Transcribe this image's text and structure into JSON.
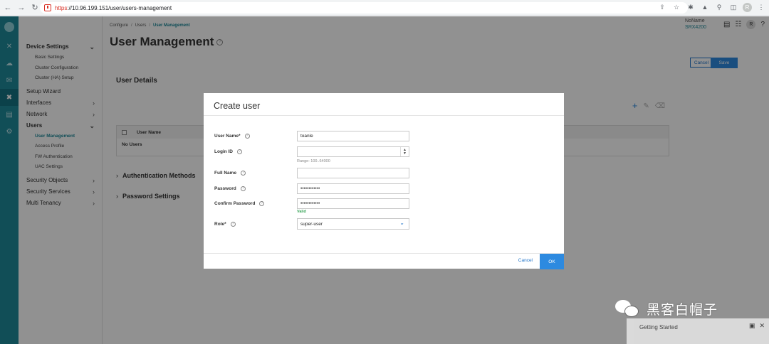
{
  "browser": {
    "url_scheme": "https",
    "url_rest": "://10.96.199.151/user/users-management",
    "profile_initial": "R"
  },
  "header": {
    "breadcrumb": [
      "Configure",
      "Users",
      "User Management"
    ],
    "page_title": "User Management",
    "device_name": "NoName",
    "device_model": "SRX4200",
    "user_initial": "R",
    "help_glyph": "?",
    "cancel_label": "Cancel",
    "save_label": "Save"
  },
  "sidebar": {
    "groups": [
      {
        "label": "Device Settings",
        "expanded": true
      },
      {
        "label": "Basic Settings"
      },
      {
        "label": "Cluster Configuration"
      },
      {
        "label": "Cluster (HA) Setup"
      },
      {
        "label": "Setup Wizard"
      },
      {
        "label": "Interfaces"
      },
      {
        "label": "Network"
      },
      {
        "label": "Users",
        "expanded": true
      },
      {
        "label": "User Management",
        "active": true
      },
      {
        "label": "Access Profile"
      },
      {
        "label": "FW Authentication"
      },
      {
        "label": "UAC Settings"
      },
      {
        "label": "Security Objects"
      },
      {
        "label": "Security Services"
      },
      {
        "label": "Multi Tenancy"
      }
    ]
  },
  "main": {
    "section_title": "User Details",
    "table": {
      "columns": [
        "User Name"
      ],
      "empty_text": "No Users"
    },
    "accordions": [
      "Authentication Methods",
      "Password Settings"
    ]
  },
  "modal": {
    "title": "Create user",
    "fields": {
      "username": {
        "label": "User Name*",
        "value": "toanle"
      },
      "login_id": {
        "label": "Login ID",
        "value": "",
        "hint": "Range: 100..64000"
      },
      "full_name": {
        "label": "Full Name",
        "value": ""
      },
      "password": {
        "label": "Password",
        "value": "••••••••••••"
      },
      "confirm_password": {
        "label": "Confirm Password",
        "value": "••••••••••••",
        "status": "Valid"
      },
      "role": {
        "label": "Role*",
        "value": "super-user"
      }
    },
    "cancel_label": "Cancel",
    "ok_label": "OK"
  },
  "overlay_widgets": {
    "getting_started": "Getting Started",
    "watermark": "黑客白帽子"
  },
  "colors": {
    "accent": "#1f8a9a",
    "primary_button": "#2d8ae0",
    "valid": "#3aa55a",
    "url_warning": "#d93025"
  }
}
